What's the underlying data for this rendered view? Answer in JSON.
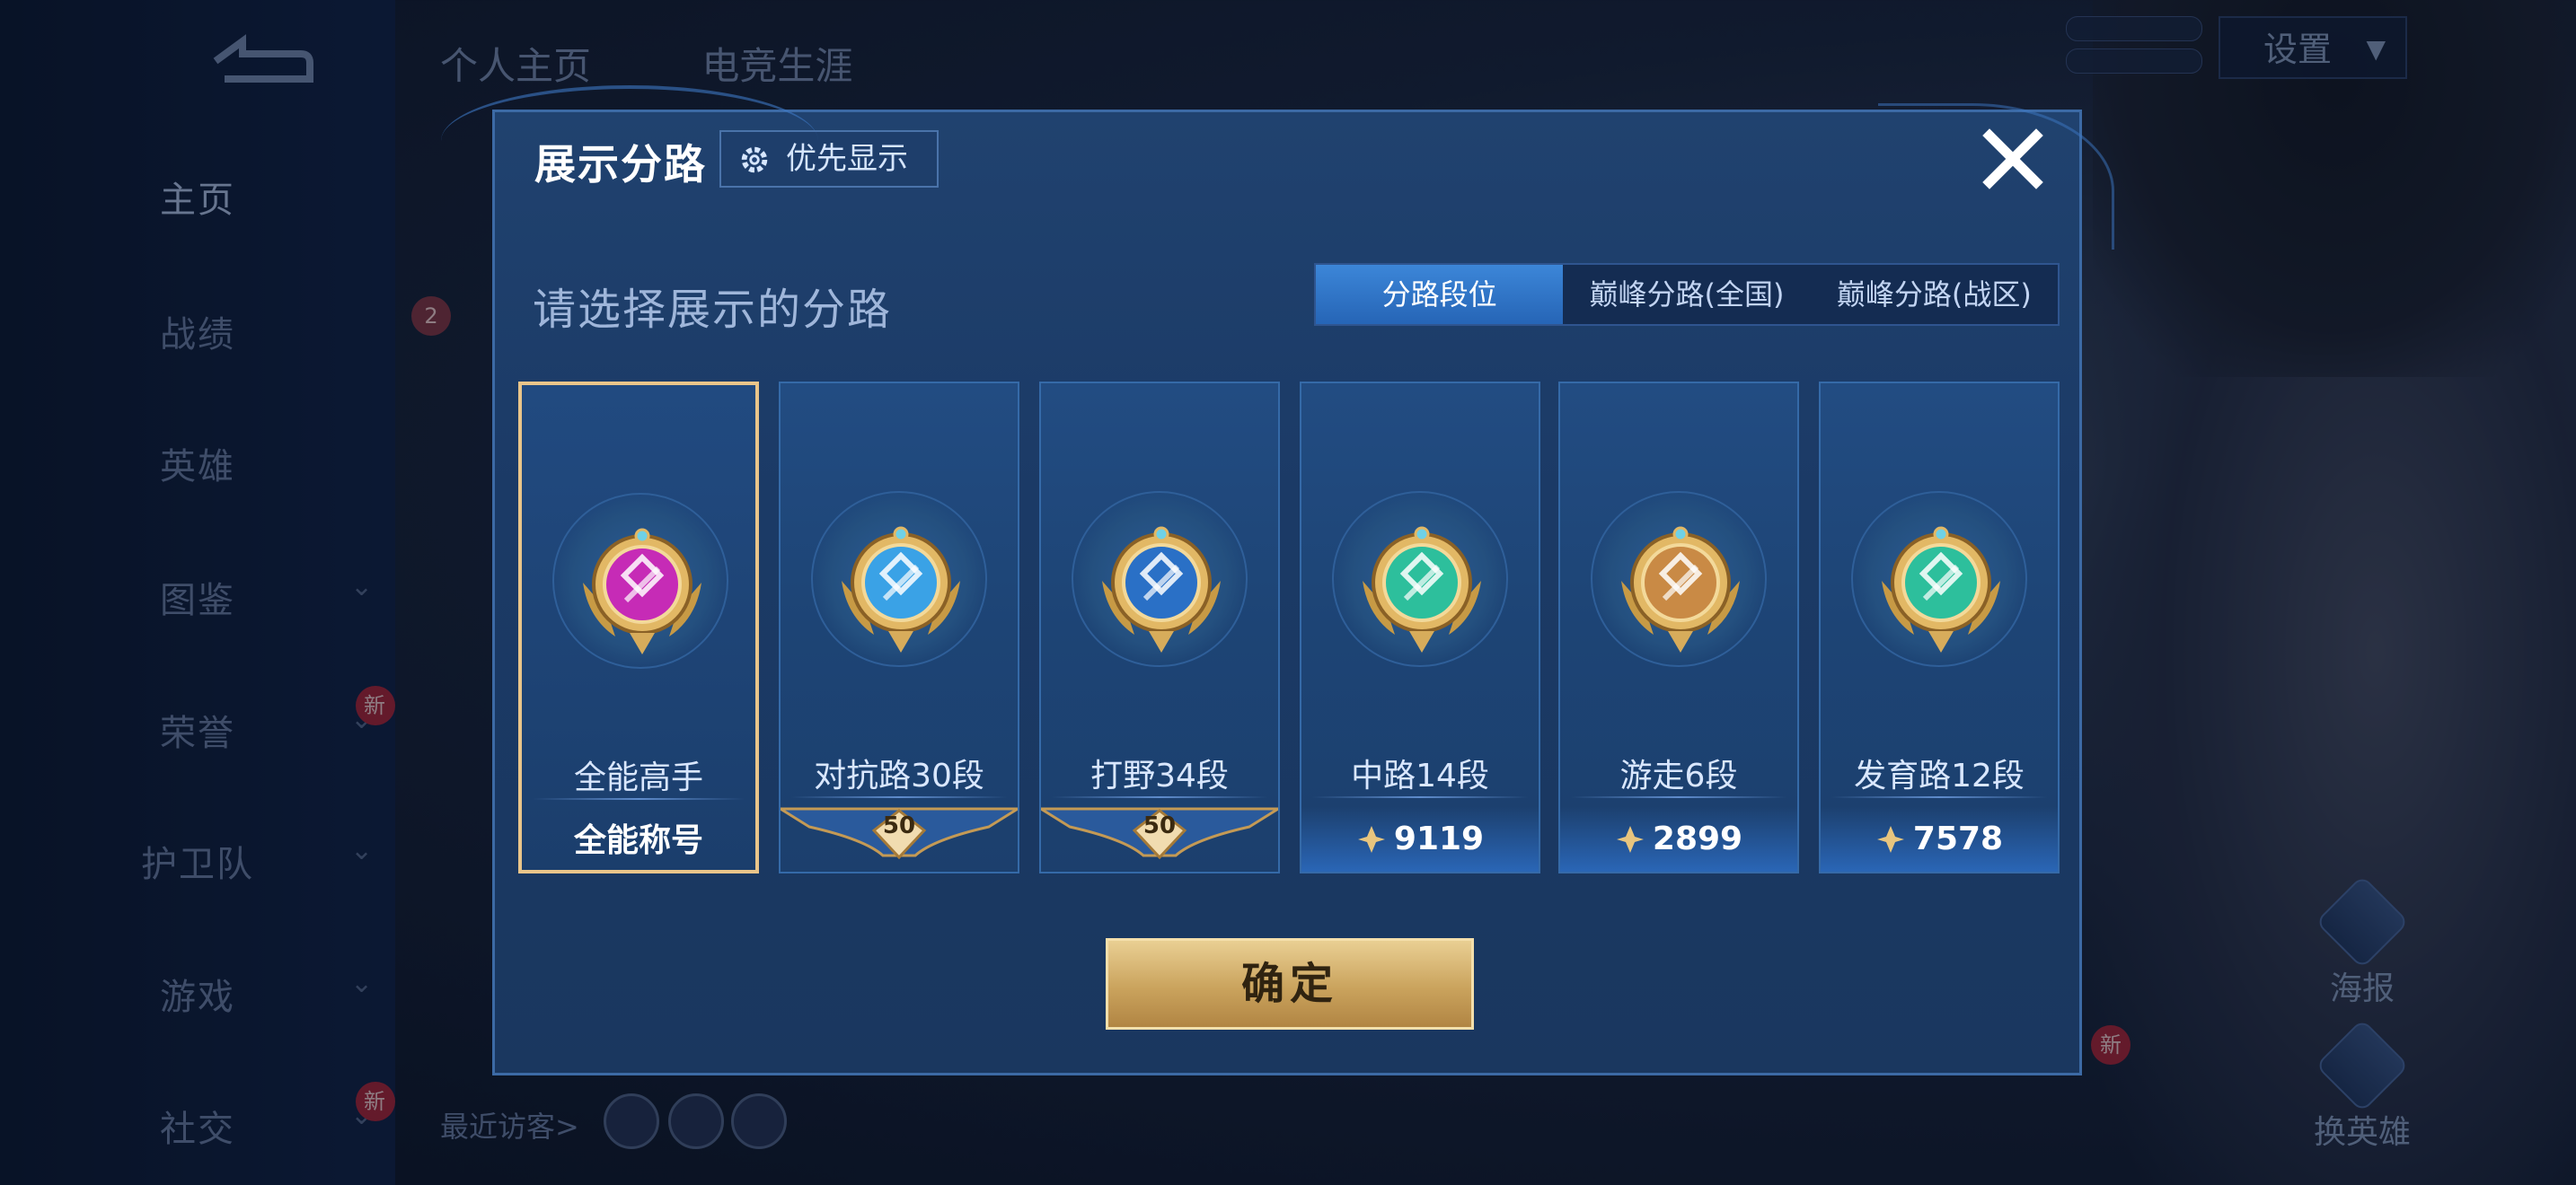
{
  "background": {
    "top_tabs": [
      "个人主页",
      "电竞生涯"
    ],
    "settings_label": "设置",
    "sidebar": [
      {
        "label": "主页",
        "active": true
      },
      {
        "label": "战绩"
      },
      {
        "label": "英雄"
      },
      {
        "label": "图鉴",
        "chevron": true
      },
      {
        "label": "荣誉",
        "chevron": true,
        "badge": "新"
      },
      {
        "label": "护卫队",
        "chevron": true
      },
      {
        "label": "游戏",
        "chevron": true
      },
      {
        "label": "社交",
        "chevron": true,
        "badge": "新"
      }
    ],
    "side_badge_count": "2",
    "visitors_label": "最近访客>",
    "right_buttons": [
      {
        "label": "海报"
      },
      {
        "label": "换英雄"
      }
    ],
    "bottom_right_badge": "新"
  },
  "dialog": {
    "title": "展示分路",
    "priority_button": "优先显示",
    "prompt": "请选择展示的分路",
    "segments": [
      {
        "label": "分路段位",
        "active": true
      },
      {
        "label": "巅峰分路(全国)"
      },
      {
        "label": "巅峰分路(战区)"
      }
    ],
    "cards": [
      {
        "name": "全能高手",
        "footer": "全能称号",
        "selected": true,
        "badge_color": "#c62bb6",
        "footer_type": "text"
      },
      {
        "name": "对抗路30段",
        "level": "50",
        "badge_color": "#3aa2e6",
        "footer_type": "plate"
      },
      {
        "name": "打野34段",
        "level": "50",
        "badge_color": "#2a70c6",
        "footer_type": "plate"
      },
      {
        "name": "中路14段",
        "points": "9119",
        "badge_color": "#2dbf9c",
        "footer_type": "points"
      },
      {
        "name": "游走6段",
        "points": "2899",
        "badge_color": "#c98a45",
        "footer_type": "points"
      },
      {
        "name": "发育路12段",
        "points": "7578",
        "badge_color": "#2dbf9c",
        "footer_type": "points"
      }
    ],
    "confirm_label": "确定"
  },
  "colors": {
    "accent_gold": "#e9c58a",
    "segment_active": "#2e74c8"
  }
}
